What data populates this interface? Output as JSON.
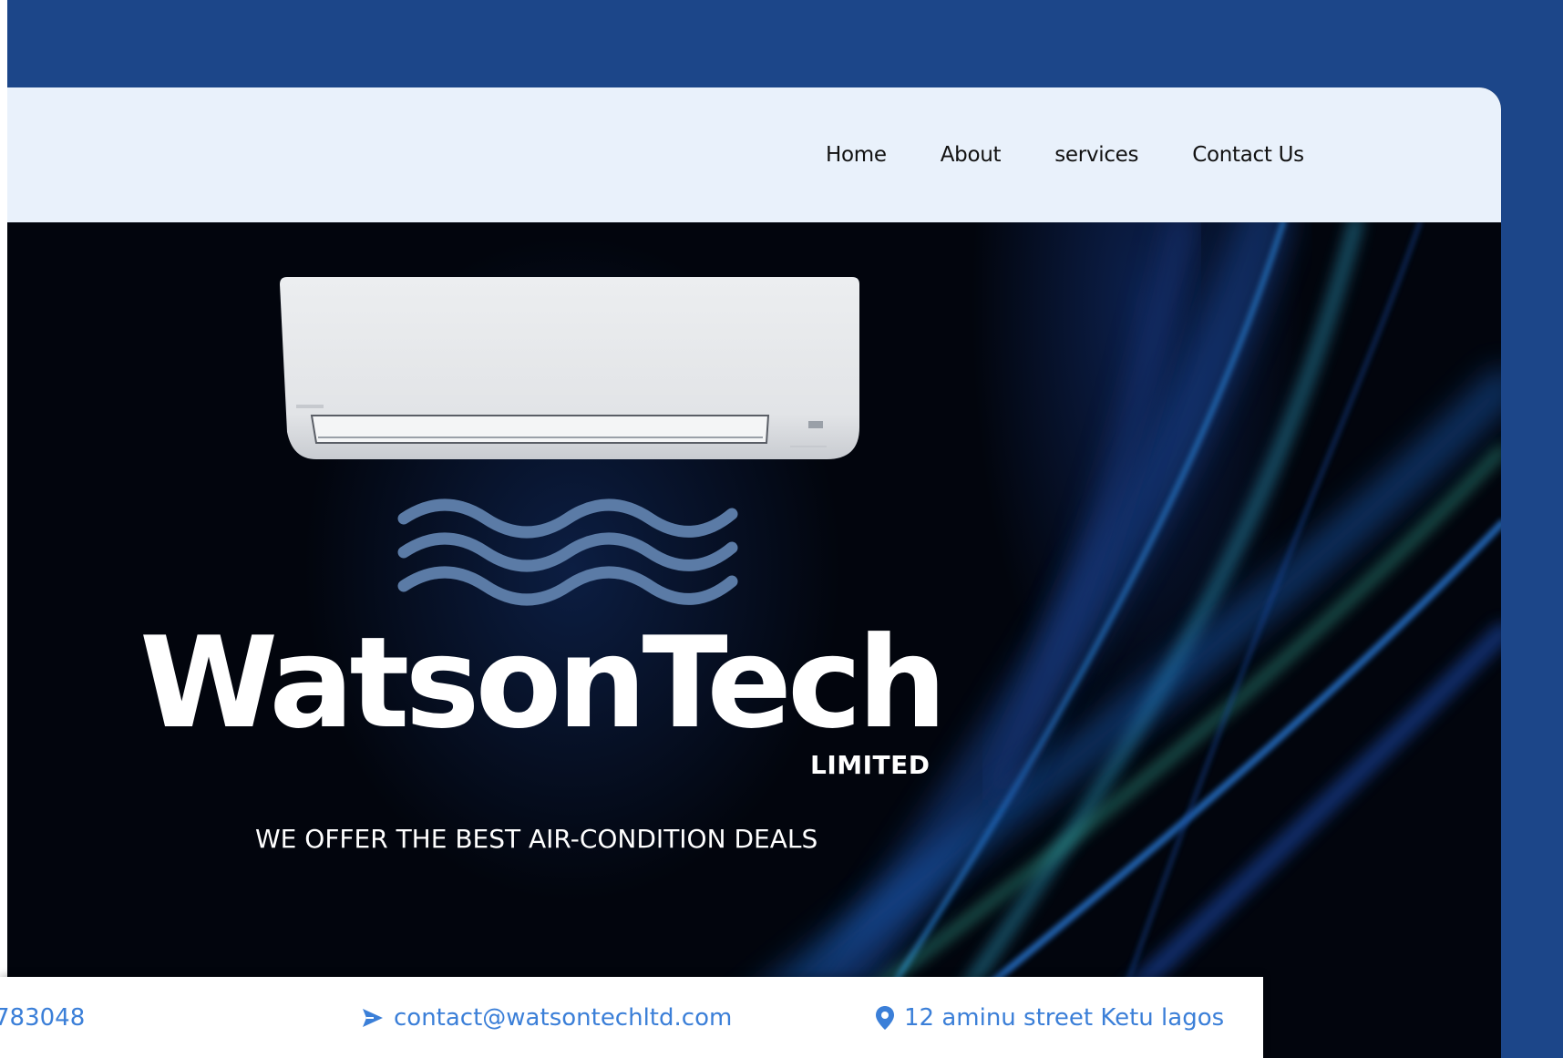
{
  "nav": {
    "items": [
      {
        "label": "Home"
      },
      {
        "label": "About"
      },
      {
        "label": "services"
      },
      {
        "label": "Contact Us"
      }
    ]
  },
  "hero": {
    "brand_title": "WatsonTech",
    "brand_subtitle": "LIMITED",
    "tagline": "WE OFFER THE BEST AIR-CONDITION DEALS",
    "image": "air-conditioner-unit",
    "wind_icon": "wind-waves-icon"
  },
  "contact": {
    "phone": "783048",
    "email": "contact@watsontechltd.com",
    "address": "12 aminu street Ketu lagos",
    "phone_icon": "phone-icon",
    "email_icon": "send-icon",
    "address_icon": "map-pin-icon"
  },
  "colors": {
    "frame_blue": "#1c4689",
    "navbar_bg": "#e9f1fb",
    "hero_bg": "#02050d",
    "contact_text": "#3b7fd8",
    "wind": "#5b7ba6"
  }
}
